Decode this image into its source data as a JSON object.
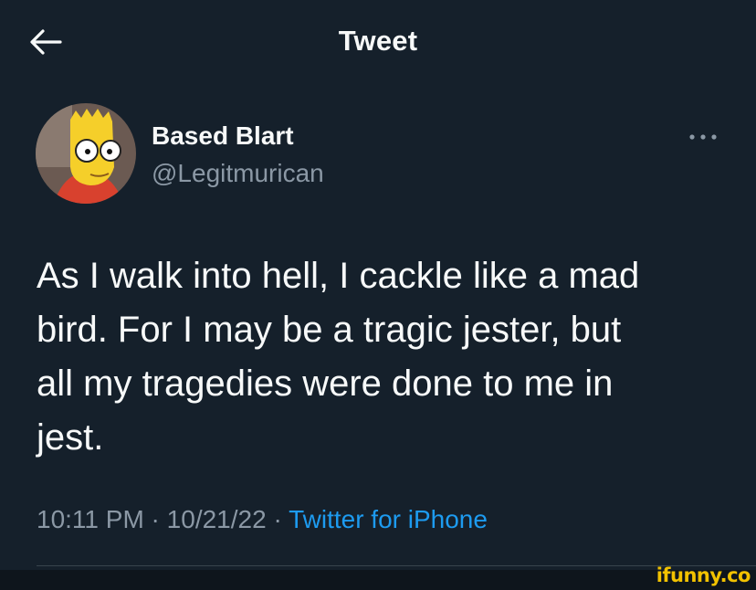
{
  "header": {
    "back_icon": "arrow-left-icon",
    "title": "Tweet"
  },
  "author": {
    "avatar_icon": "avatar-cartoon",
    "name": "Based Blart",
    "handle": "@Legitmurican",
    "more_icon": "more-dots-icon"
  },
  "tweet": {
    "text": "As I walk into hell, I cackle like a mad\nbird. For I may be a tragic jester, but\nall my tragedies were done to me in\njest."
  },
  "meta": {
    "time": "10:11 PM",
    "separator": " · ",
    "date": "10/21/22",
    "source": "Twitter for iPhone"
  },
  "watermark": {
    "text": "ifunny.co"
  },
  "colors": {
    "background": "#15202b",
    "primary_text": "#f7f9f9",
    "secondary_text": "#8b98a5",
    "link": "#1d9bf0",
    "watermark": "#f2c200"
  }
}
